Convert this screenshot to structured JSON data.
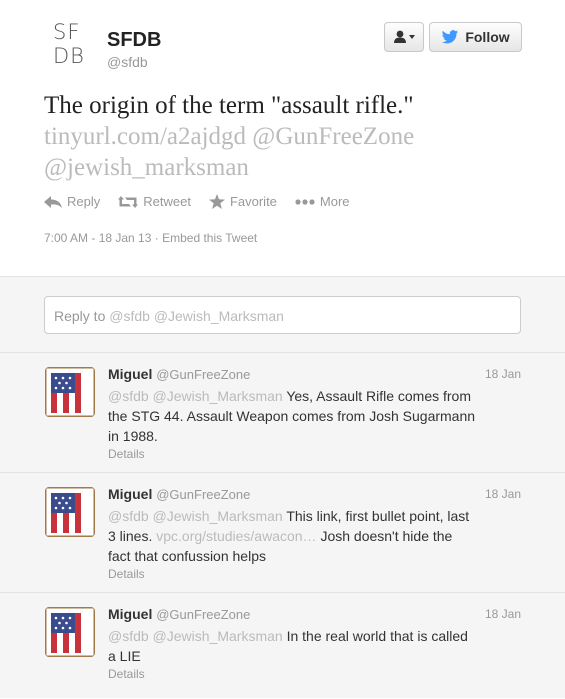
{
  "profile": {
    "logo_line1": "SF",
    "logo_line2": "DB",
    "name": "SFDB",
    "handle": "@sfdb",
    "follow_label": "Follow"
  },
  "tweet": {
    "text": "The origin of the term \"assault rifle.\"",
    "link": "tinyurl.com/a2ajdgd",
    "mention1": "@GunFreeZone",
    "mention2": "@jewish_marksman",
    "actions": {
      "reply": "Reply",
      "retweet": "Retweet",
      "favorite": "Favorite",
      "more": "More"
    },
    "timestamp": "7:00 AM - 18 Jan 13",
    "separator": "·",
    "embed": "Embed this Tweet"
  },
  "reply_box": {
    "prefix": "Reply to ",
    "mentions": "@sfdb @Jewish_Marksman"
  },
  "replies": [
    {
      "name": "Miguel",
      "handle": "@GunFreeZone",
      "time": "18 Jan",
      "mentions": "@sfdb @Jewish_Marksman",
      "text": " Yes, Assault Rifle comes from the STG 44. Assault Weapon comes from Josh Sugarmann in 1988.",
      "details": "Details"
    },
    {
      "name": "Miguel",
      "handle": "@GunFreeZone",
      "time": "18 Jan",
      "mentions": "@sfdb @Jewish_Marksman",
      "text": " This link, first bullet point, last 3 lines. ",
      "link": "vpc.org/studies/awacon…",
      "text2": " Josh doesn't hide the fact that confussion helps",
      "details": "Details"
    },
    {
      "name": "Miguel",
      "handle": "@GunFreeZone",
      "time": "18 Jan",
      "mentions": "@sfdb @Jewish_Marksman",
      "text": " In the real world that is called a LIE",
      "details": "Details"
    }
  ],
  "colors": {
    "accent_blue": "#4099ff",
    "flag_red": "#c8323a",
    "flag_blue": "#3a4b8e"
  }
}
